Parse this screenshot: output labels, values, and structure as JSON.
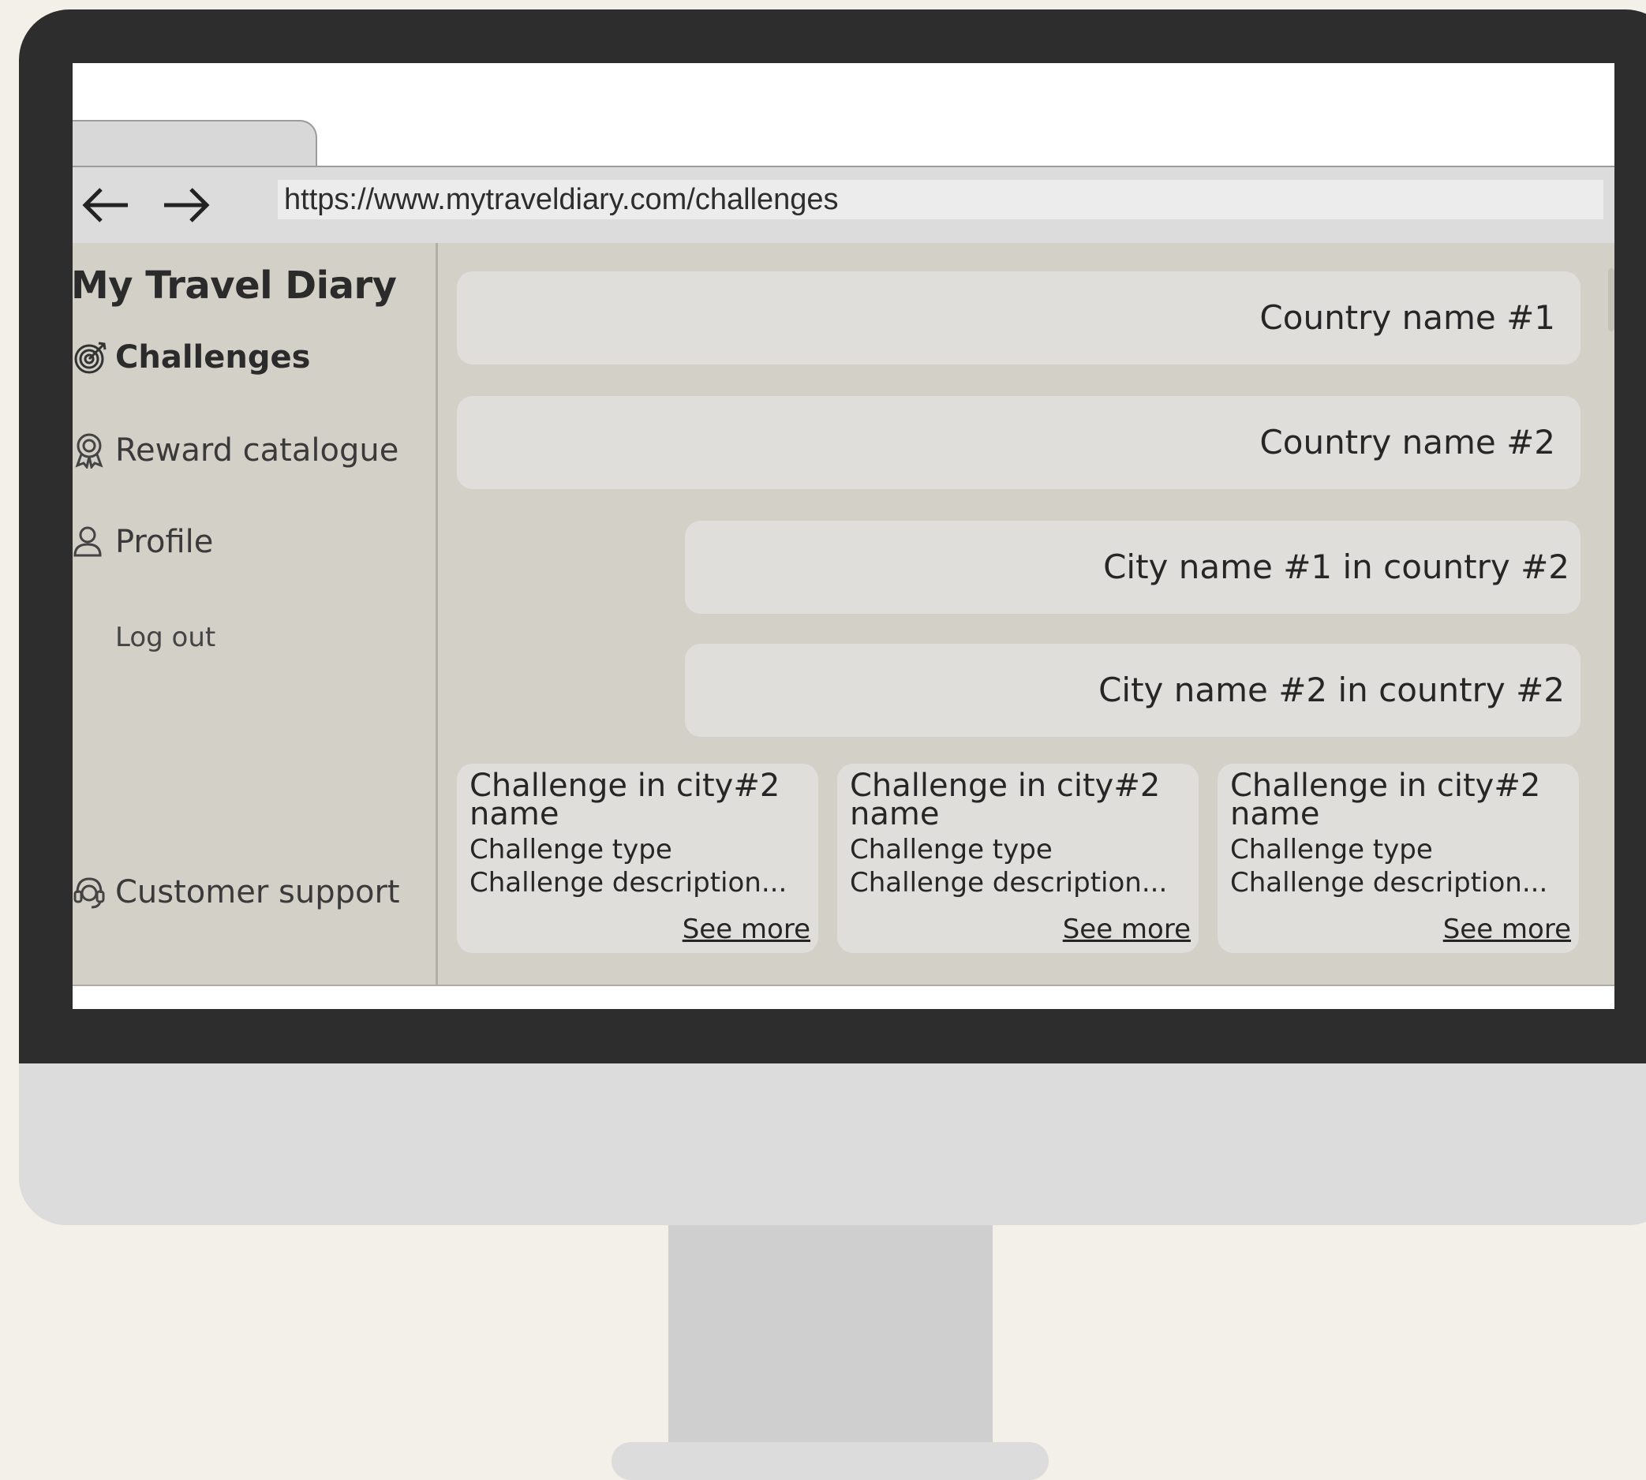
{
  "browser": {
    "url": "https://www.mytraveldiary.com/challenges",
    "back_icon": "arrow-left-icon",
    "forward_icon": "arrow-right-icon"
  },
  "sidebar": {
    "brand": "My Travel Diary",
    "items": [
      {
        "label": "Challenges",
        "icon": "target-icon",
        "active": true
      },
      {
        "label": "Reward catalogue",
        "icon": "award-icon"
      },
      {
        "label": "Profile",
        "icon": "user-icon"
      }
    ],
    "logout": "Log out",
    "support": {
      "label": "Customer support",
      "icon": "headset-icon"
    }
  },
  "main": {
    "countries": [
      {
        "label": "Country name #1"
      },
      {
        "label": "Country name #2"
      }
    ],
    "cities": [
      {
        "label": "City name #1 in country #2"
      },
      {
        "label": "City name #2 in country #2"
      }
    ],
    "challenges": [
      {
        "title": "Challenge in city#2 name",
        "type": "Challenge type",
        "description": "Challenge description...",
        "more": "See more"
      },
      {
        "title": "Challenge in city#2 name",
        "type": "Challenge type",
        "description": "Challenge description...",
        "more": "See more"
      },
      {
        "title": "Challenge in city#2 name",
        "type": "Challenge type",
        "description": "Challenge description...",
        "more": "See more"
      }
    ]
  },
  "colors": {
    "bezel": "#2d2d2d",
    "app_background": "#d3d0c8",
    "card": "#dfdeda"
  }
}
